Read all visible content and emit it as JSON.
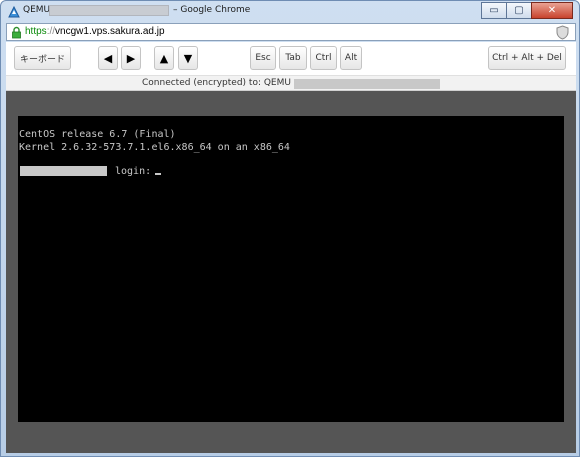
{
  "window": {
    "title_prefix": "QEMU",
    "title_suffix": "– Google Chrome",
    "controls": {
      "minimize": "▭",
      "maximize": "▢",
      "close": "✕"
    }
  },
  "address": {
    "scheme": "https",
    "slashes": "://",
    "host": "vncgw1.vps.sakura.ad.jp"
  },
  "toolbar": {
    "keyboard_label": "キーボード",
    "left_arrow": "◀",
    "right_arrow": "▶",
    "up_arrow": "▲",
    "down_arrow": "▼",
    "esc_label": "Esc",
    "tab_label": "Tab",
    "ctrl_label": "Ctrl",
    "alt_label": "Alt",
    "cad_label": "Ctrl + Alt + Del"
  },
  "status": {
    "text": "Connected (encrypted) to: QEMU"
  },
  "terminal": {
    "line1": "CentOS release 6.7 (Final)",
    "line2": "Kernel 2.6.32-573.7.1.el6.x86_64 on an x86_64",
    "login_prompt": "login:",
    "cursor": "_"
  },
  "colors": {
    "terminal_bg": "#000000",
    "terminal_fg": "#c8c8c8",
    "viewer_bg": "#555555",
    "url_scheme": "#0a8a0a"
  },
  "icons": {
    "app": "qemu-app-icon",
    "lock": "lock-icon",
    "security": "shield-icon"
  }
}
